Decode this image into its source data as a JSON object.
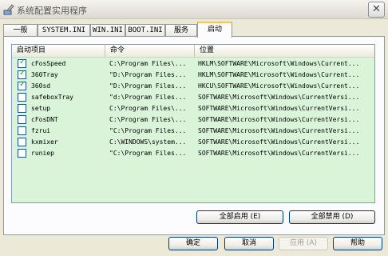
{
  "window": {
    "title": "系统配置实用程序",
    "close_glyph": "✕"
  },
  "tabs": [
    {
      "label": "一般",
      "active": false
    },
    {
      "label": "SYSTEM.INI",
      "active": false
    },
    {
      "label": "WIN.INI",
      "active": false
    },
    {
      "label": "BOOT.INI",
      "active": false
    },
    {
      "label": "服务",
      "active": false
    },
    {
      "label": "启动",
      "active": true
    }
  ],
  "startup_list": {
    "columns": [
      "启动项目",
      "命令",
      "位置"
    ],
    "rows": [
      {
        "checked": true,
        "item": "cFosSpeed",
        "command": "C:\\Program Files\\...",
        "location": "HKLM\\SOFTWARE\\Microsoft\\Windows\\Current..."
      },
      {
        "checked": true,
        "item": "360Tray",
        "command": "\"D:\\Program Files...",
        "location": "HKLM\\SOFTWARE\\Microsoft\\Windows\\Current..."
      },
      {
        "checked": true,
        "item": "360sd",
        "command": "\"D:\\Program Files...",
        "location": "HKCU\\SOFTWARE\\Microsoft\\Windows\\Current..."
      },
      {
        "checked": false,
        "item": "safeboxTray",
        "command": "\"d:\\Program Files...",
        "location": "SOFTWARE\\Microsoft\\Windows\\CurrentVersi..."
      },
      {
        "checked": false,
        "item": "setup",
        "command": "C:\\Program Files\\...",
        "location": "SOFTWARE\\Microsoft\\Windows\\CurrentVersi..."
      },
      {
        "checked": false,
        "item": "cFosDNT",
        "command": "C:\\Program Files\\...",
        "location": "SOFTWARE\\Microsoft\\Windows\\CurrentVersi..."
      },
      {
        "checked": false,
        "item": "fzrui",
        "command": "\"C:\\Program Files...",
        "location": "SOFTWARE\\Microsoft\\Windows\\CurrentVersi..."
      },
      {
        "checked": false,
        "item": "kxmixer",
        "command": "C:\\WINDOWS\\system...",
        "location": "SOFTWARE\\Microsoft\\Windows\\CurrentVersi..."
      },
      {
        "checked": false,
        "item": "runiep",
        "command": "\"C:\\Program Files...",
        "location": "SOFTWARE\\Microsoft\\Windows\\CurrentVersi..."
      }
    ]
  },
  "actions": {
    "enable_all": "全部启用 (E)",
    "disable_all": "全部禁用 (D)"
  },
  "dialog_buttons": {
    "ok": "确定",
    "cancel": "取消",
    "apply": "应用 (A)",
    "help": "帮助"
  },
  "colors": {
    "list_background": "#d9f4d9",
    "active_tab_accent": "#ffc83c",
    "check_green": "#21a121"
  }
}
